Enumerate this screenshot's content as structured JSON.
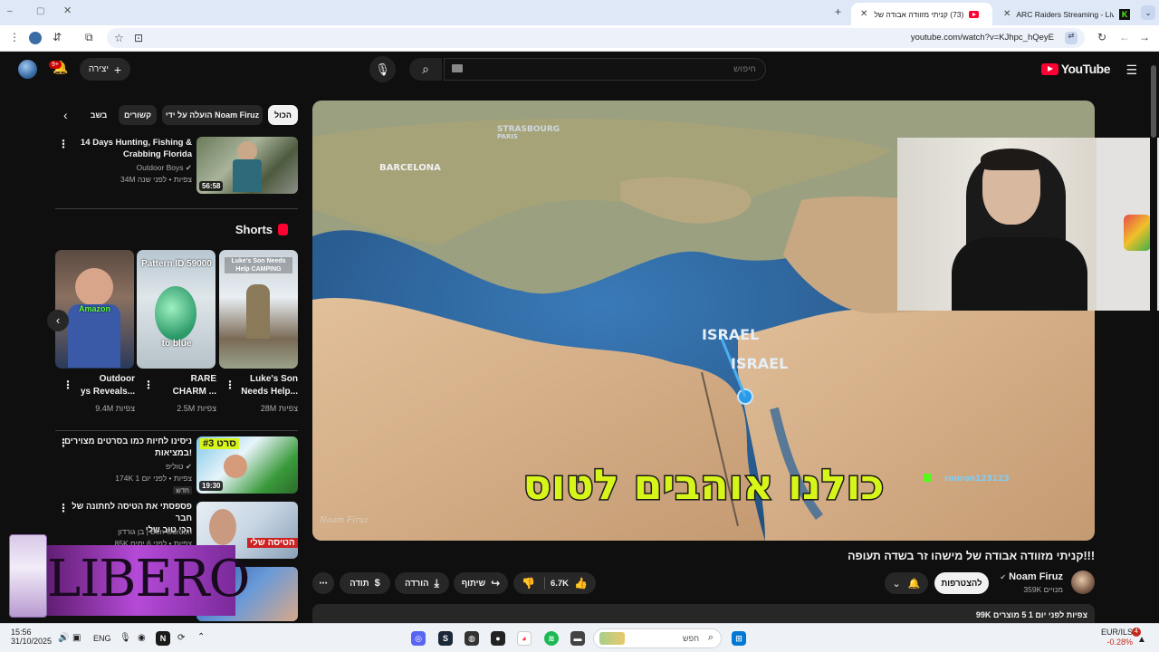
{
  "browser": {
    "tabs": [
      {
        "title": "(73) קניתי מזוודה אבודה של מישו",
        "active": true
      },
      {
        "title": "ARC Raiders Streaming - Live S",
        "active": false
      }
    ],
    "url": "youtube.com/watch?v=KJhpc_hQeyE"
  },
  "header": {
    "logo_text": "YouTube",
    "search_placeholder": "חיפוש",
    "create_label": "יצירה",
    "notif_count": "9+"
  },
  "chips": [
    "הכול",
    "הועלה על ידי Noam Firuz",
    "קשורים",
    "בשב"
  ],
  "related_top": {
    "title_line1": "14 Days Hunting, Fishing &",
    "title_line2": "Crabbing Florida",
    "channel": "Outdoor Boys",
    "meta": "34M צפיות • לפני שנה",
    "duration": "56:58"
  },
  "shorts": {
    "heading": "Shorts",
    "items": [
      {
        "title1": "Luke's Son",
        "title2": "Needs Help...",
        "views": "28M צפיות",
        "overlay": "Luke's Son Needs Help CAMPING"
      },
      {
        "title1": "RARE",
        "title2": "CHARM ...",
        "views": "2.5M צפיות",
        "overlay": "Pattern ID 59000",
        "overlay2": "to blue"
      },
      {
        "title1": "Outdoor",
        "title2": "ys Reveals...",
        "views": "9.4M צפיות",
        "overlay": "Amazon"
      }
    ]
  },
  "related_list": [
    {
      "title_line1": "ניסינו לחיות כמו בסרטים מצוירים",
      "title_line2": "במציאות!",
      "channel": "טוליפ",
      "meta": "174K צפיות • לפני יום 1",
      "badge": "חדש",
      "duration": "19:30",
      "overlay": "סרט #3"
    },
    {
      "title_line1": "פספסתי את הטיסה לחתונה של חבר",
      "title_line2": "הכי טוב שלי",
      "channel": "בן גורדון | Ben Gordon",
      "meta": "85K צפיות • לפני 6 ימים",
      "overlay": "הטיסה שלי"
    }
  ],
  "player": {
    "labels": [
      "STRASBOURG",
      "PARIS",
      "BARCELONA",
      "ISRAEL",
      "ISRAEL"
    ],
    "caption": "כולנו אוהבים לטוס",
    "chat_user": "ronron123123",
    "watermark": "Noam Firuz"
  },
  "overlay_brand": "LIBERO",
  "video": {
    "title": "קניתי מזוודה אבודה של מישהו זר בשדה תעופה!!!",
    "channel": "Noam Firuz",
    "subscribers": "359K מנויים",
    "subscribe_label": "להצטרפות",
    "likes": "6.7K",
    "share_label": "שיתוף",
    "download_label": "הורדה",
    "thanks_label": "תודה",
    "desc_meta": "99K צפיות  לפני יום 1  5 מוצרים"
  },
  "taskbar": {
    "time": "15:56",
    "date": "31/10/2025",
    "lang": "ENG",
    "search_placeholder": "חפש",
    "currency": "EUR/ILS",
    "currency_change": "-0.28%",
    "tray_badge": "4"
  },
  "colors": {
    "yt_red": "#ff0033",
    "bg": "#0f0f0f",
    "caption_yellow": "#d8f51a"
  }
}
